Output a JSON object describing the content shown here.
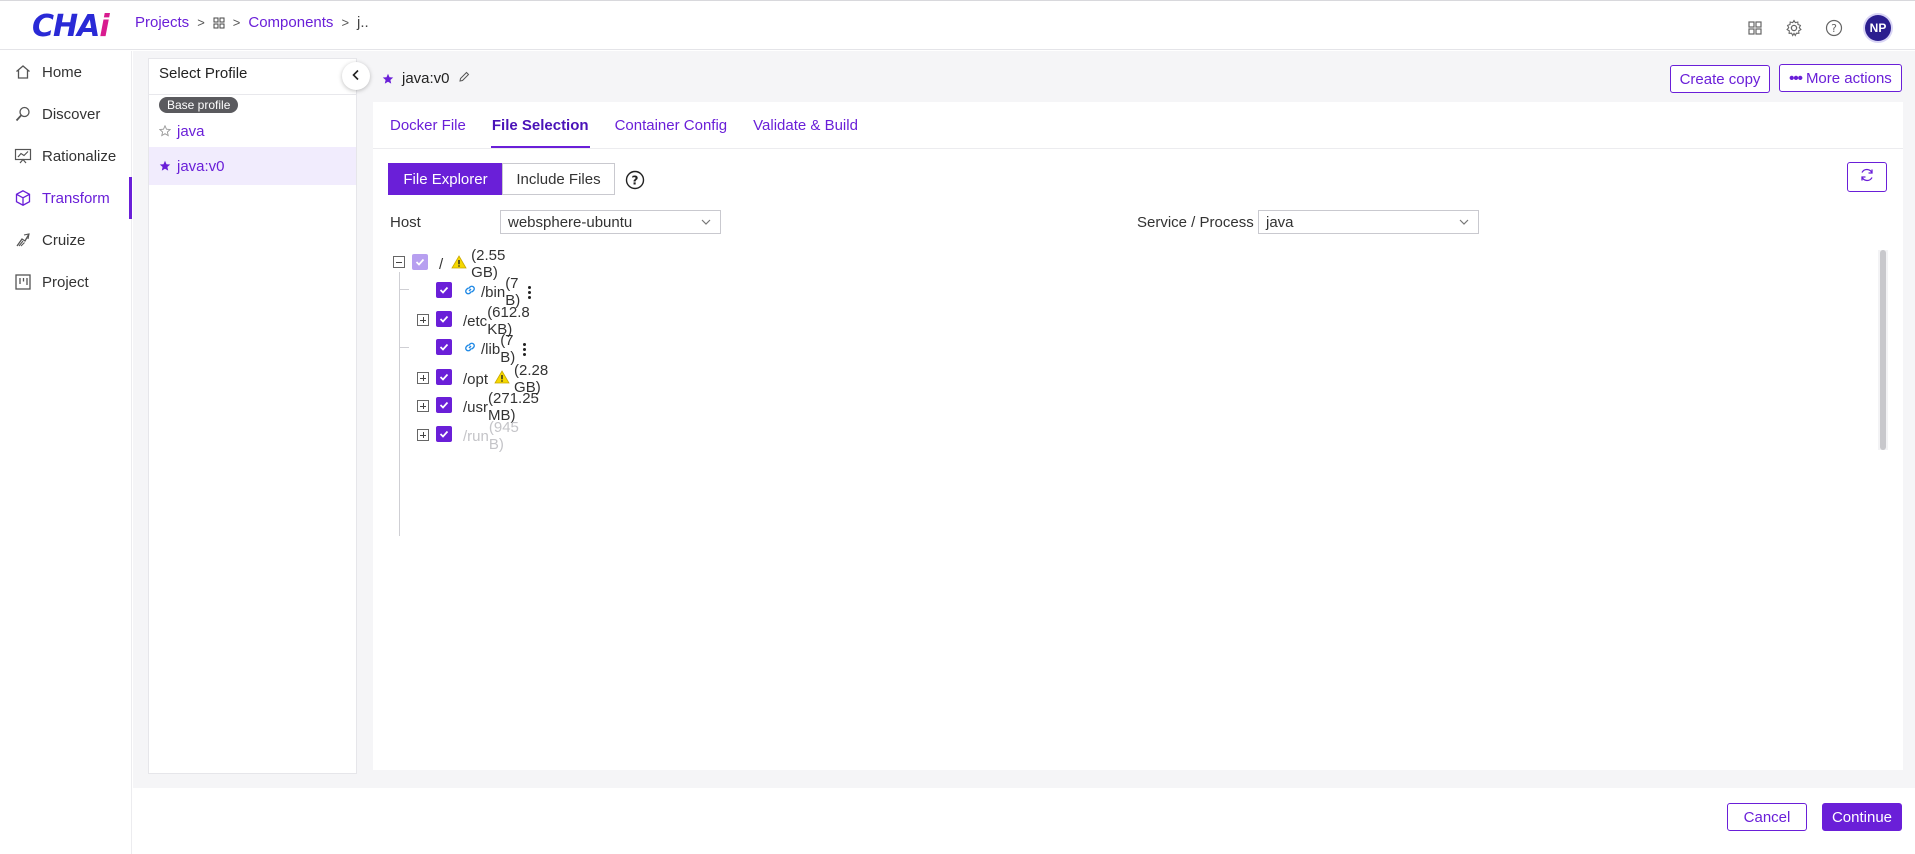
{
  "app": {
    "logo_main": "CHA",
    "logo_accent": "i"
  },
  "breadcrumb": {
    "projects": "Projects",
    "components": "Components",
    "current": "j.."
  },
  "header_icons": [
    "apps-grid-icon",
    "gear-icon",
    "help-circle-icon"
  ],
  "user": {
    "initials": "NP"
  },
  "nav": {
    "items": [
      {
        "label": "Home",
        "icon": "home-icon"
      },
      {
        "label": "Discover",
        "icon": "discover-icon"
      },
      {
        "label": "Rationalize",
        "icon": "rationalize-icon"
      },
      {
        "label": "Transform",
        "icon": "cube-icon",
        "active": true
      },
      {
        "label": "Cruize",
        "icon": "cruize-icon"
      },
      {
        "label": "Project",
        "icon": "project-icon"
      }
    ]
  },
  "profiles": {
    "title": "Select Profile",
    "base_badge": "Base profile",
    "items": [
      {
        "label": "java",
        "starred": false
      },
      {
        "label": "java:v0",
        "starred": true,
        "selected": true
      }
    ]
  },
  "main": {
    "profile_name": "java:v0",
    "create_copy": "Create copy",
    "more_actions": "More actions",
    "tabs": [
      {
        "label": "Docker File"
      },
      {
        "label": "File Selection",
        "active": true
      },
      {
        "label": "Container Config"
      },
      {
        "label": "Validate & Build"
      }
    ],
    "mode": {
      "file_explorer": "File Explorer",
      "include_files": "Include Files"
    },
    "host": {
      "label": "Host",
      "value": "websphere-ubuntu"
    },
    "service": {
      "label": "Service / Process",
      "value": "java"
    },
    "tree": {
      "root": {
        "name": "/",
        "size": "(2.55 GB)",
        "warning": true
      },
      "children": [
        {
          "name": "/bin",
          "size": "(7 B)",
          "link": true,
          "expandable": false
        },
        {
          "name": "/etc",
          "size": "(612.8 KB)",
          "link": false,
          "expandable": true
        },
        {
          "name": "/lib",
          "size": "(7 B)",
          "link": true,
          "expandable": false
        },
        {
          "name": "/opt",
          "size": "(2.28 GB)",
          "link": false,
          "expandable": true,
          "warning": true
        },
        {
          "name": "/usr",
          "size": "(271.25 MB)",
          "link": false,
          "expandable": true
        },
        {
          "name": "/run",
          "size": "(945 B)",
          "link": false,
          "expandable": true,
          "dimmed": true
        }
      ]
    }
  },
  "footer": {
    "cancel": "Cancel",
    "continue": "Continue"
  },
  "colors": {
    "accent": "#6a1fd8",
    "warning": "#f5d800",
    "link_icon": "#1e88e5"
  }
}
